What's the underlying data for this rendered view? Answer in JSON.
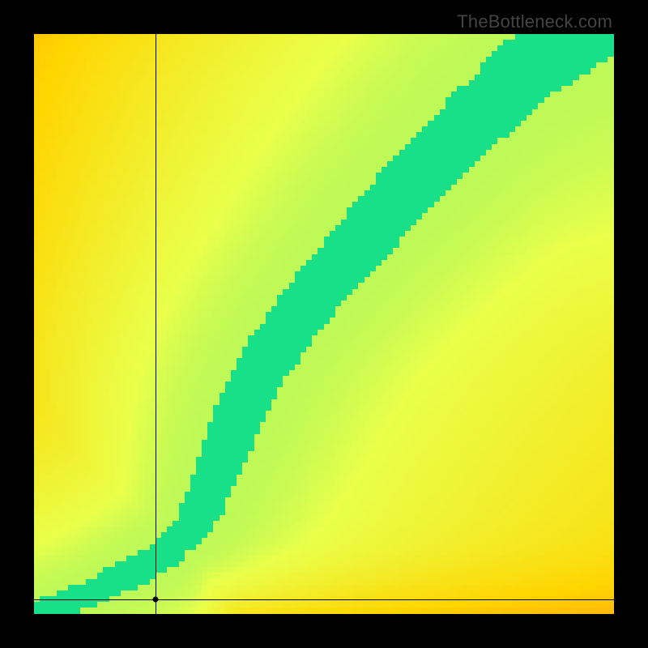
{
  "watermark": {
    "text": "TheBottleneck.com"
  },
  "chart_data": {
    "type": "heatmap",
    "colorscale": "red-orange-yellow-green",
    "colorscale_stops": [
      {
        "t": 0.0,
        "hex": "#ff2a44"
      },
      {
        "t": 0.25,
        "hex": "#ff7a2a"
      },
      {
        "t": 0.5,
        "hex": "#ffd500"
      },
      {
        "t": 0.75,
        "hex": "#e9ff4a"
      },
      {
        "t": 1.0,
        "hex": "#17e089"
      }
    ],
    "x_range": [
      0,
      1
    ],
    "y_range": [
      0,
      1
    ],
    "grid": 100,
    "ridge": [
      {
        "x": 0.0,
        "y": 0.0
      },
      {
        "x": 0.05,
        "y": 0.015
      },
      {
        "x": 0.1,
        "y": 0.035
      },
      {
        "x": 0.15,
        "y": 0.06
      },
      {
        "x": 0.2,
        "y": 0.085
      },
      {
        "x": 0.25,
        "y": 0.12
      },
      {
        "x": 0.28,
        "y": 0.16
      },
      {
        "x": 0.31,
        "y": 0.23
      },
      {
        "x": 0.34,
        "y": 0.31
      },
      {
        "x": 0.38,
        "y": 0.4
      },
      {
        "x": 0.43,
        "y": 0.48
      },
      {
        "x": 0.5,
        "y": 0.57
      },
      {
        "x": 0.58,
        "y": 0.66
      },
      {
        "x": 0.66,
        "y": 0.75
      },
      {
        "x": 0.74,
        "y": 0.83
      },
      {
        "x": 0.82,
        "y": 0.91
      },
      {
        "x": 0.9,
        "y": 0.98
      },
      {
        "x": 0.95,
        "y": 1.01
      }
    ],
    "ridge_width_base": 0.02,
    "ridge_width_gain": 0.06,
    "crosshair": {
      "x": 0.21,
      "y": 0.025
    },
    "title": "",
    "xlabel": "",
    "ylabel": ""
  }
}
